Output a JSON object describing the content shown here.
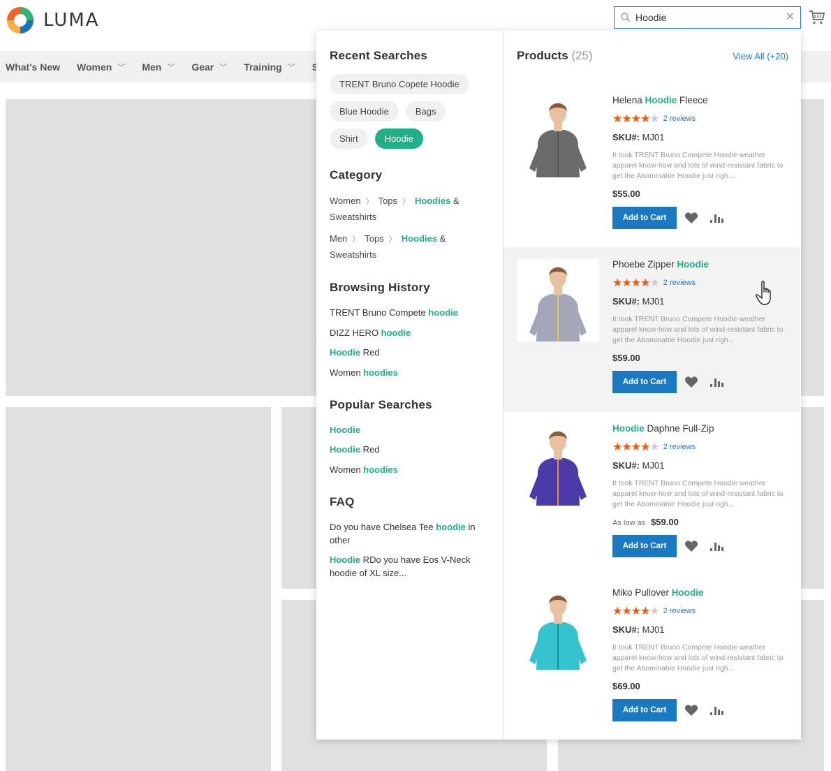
{
  "header": {
    "brand": "LUMA",
    "search_value": "Hoodie"
  },
  "nav": [
    {
      "label": "What's New",
      "has_menu": false
    },
    {
      "label": "Women",
      "has_menu": true
    },
    {
      "label": "Men",
      "has_menu": true
    },
    {
      "label": "Gear",
      "has_menu": true
    },
    {
      "label": "Training",
      "has_menu": true
    },
    {
      "label": "S",
      "has_menu": false
    }
  ],
  "recent": {
    "title": "Recent Searches",
    "chips": [
      "TRENT Bruno Copete Hoodie",
      "Blue Hoodie",
      "Bags",
      "Shirt",
      "Hoodie"
    ],
    "active_chip": "Hoodie"
  },
  "category": {
    "title": "Category",
    "items": [
      {
        "c1": "Women",
        "c2": "Tops",
        "hl": "Hoodies",
        "rest": " &",
        "line2": "Sweatshirts"
      },
      {
        "c1": "Men",
        "c2": "Tops",
        "hl": "Hoodies",
        "rest": " &",
        "line2": "Sweatshirts"
      }
    ]
  },
  "history": {
    "title": "Browsing History",
    "items": [
      {
        "pre": "TRENT Bruno Compete ",
        "hl": "hoodie",
        "post": ""
      },
      {
        "pre": "DIZZ HERO ",
        "hl": "hoodie",
        "post": ""
      },
      {
        "pre": "",
        "hl": "Hoodie",
        "post": " Red"
      },
      {
        "pre": "Women ",
        "hl": "hoodies",
        "post": ""
      }
    ]
  },
  "popular": {
    "title": "Popular Searches",
    "items": [
      {
        "pre": "",
        "hl": "Hoodie",
        "post": ""
      },
      {
        "pre": "",
        "hl": "Hoodie",
        "post": " Red"
      },
      {
        "pre": "Women ",
        "hl": "hoodies",
        "post": ""
      }
    ]
  },
  "faq": {
    "title": "FAQ",
    "items": [
      {
        "pre": "Do you have Chelsea Tee ",
        "hl": "hoodie",
        "post": " in other"
      },
      {
        "pre": "",
        "hl": "Hoodie",
        "post": " RDo you have Eos V-Neck hoodie of XL size..."
      }
    ]
  },
  "products": {
    "title": "Products",
    "count": "(25)",
    "view_all": "View All (+20)",
    "items": [
      {
        "pre": "Helena ",
        "hl": "Hoodie",
        "post": " Fleece",
        "rating": 4,
        "reviews": "2 reviews",
        "sku_label": "SKU#:",
        "sku": "MJ01",
        "desc": "It took TRENT Bruno Compete Hoodie weather apparel know-how and lots of wind-resistant fabric to get the Abominable Hoodie just righ...",
        "price_prefix": "",
        "price": "$55.00",
        "button": "Add to Cart",
        "hovered": false,
        "shirt_color": "#6b6b6b",
        "trim_color": "#555"
      },
      {
        "pre": "Phoebe Zipper ",
        "hl": "Hoodie",
        "post": "",
        "rating": 4,
        "reviews": "2 reviews",
        "sku_label": "SKU#:",
        "sku": "MJ01",
        "desc": "It took TRENT Bruno Compete Hoodie weather apparel know-how and lots of wind-resistant fabric to get the Abominable Hoodie just righ...",
        "price_prefix": "",
        "price": "$59.00",
        "button": "Add to Cart",
        "hovered": true,
        "shirt_color": "#a3a7b8",
        "trim_color": "#e5c84a"
      },
      {
        "pre": "",
        "hl": "Hoodie",
        "post": " Daphne Full-Zip",
        "rating": 4,
        "reviews": "2 reviews",
        "sku_label": "SKU#:",
        "sku": "MJ01",
        "desc": "It took TRENT Bruno Compete Hoodie weather apparel know-how and lots of wind-resistant fabric to get the Abominable Hoodie just righ...",
        "price_prefix": "As low as",
        "price": "$59.00",
        "button": "Add to Cart",
        "hovered": false,
        "shirt_color": "#4b3aa8",
        "trim_color": "#f08a3a"
      },
      {
        "pre": "Miko Pullover ",
        "hl": "Hoodie",
        "post": "",
        "rating": 4,
        "reviews": "2 reviews",
        "sku_label": "SKU#:",
        "sku": "MJ01",
        "desc": "It took TRENT Bruno Compete Hoodie weather apparel know-how and lots of wind-resistant fabric to get the Abominable Hoodie just righ...",
        "price_prefix": "",
        "price": "$69.00",
        "button": "Add to Cart",
        "hovered": false,
        "shirt_color": "#33c4cf",
        "trim_color": "#1d8f99"
      }
    ]
  },
  "colors": {
    "accent_green": "#1fb088",
    "primary_blue": "#1979c3",
    "star_orange": "#ff5501"
  },
  "icons": {
    "logo": "luma-logo-icon",
    "search": "search-icon",
    "clear": "close-icon",
    "cart": "cart-icon",
    "wishlist": "heart-icon",
    "compare": "compare-icon",
    "pointer": "hand-cursor-icon"
  }
}
